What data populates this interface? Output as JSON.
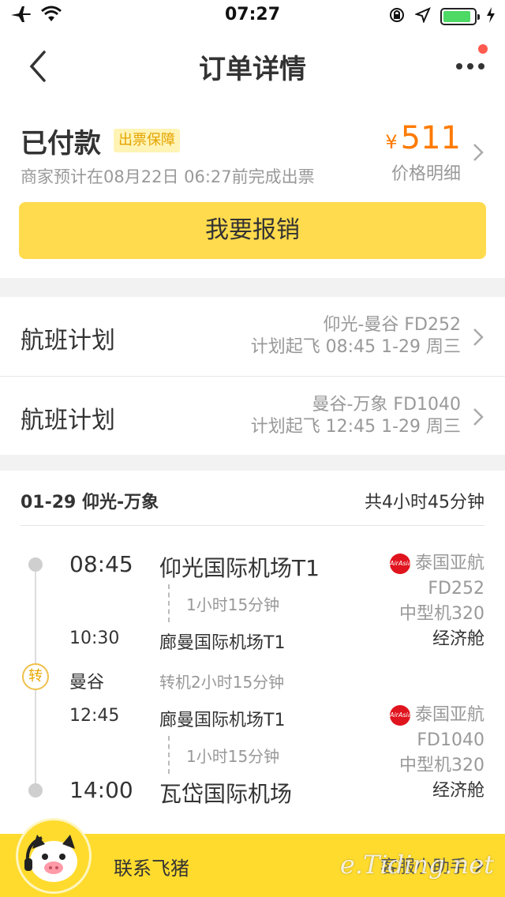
{
  "status_bar": {
    "time": "07:27"
  },
  "nav": {
    "title": "订单详情"
  },
  "order": {
    "status": "已付款",
    "badge": "出票保障",
    "issue_note": "商家预计在08月22日 06:27前完成出票",
    "currency": "¥",
    "price": "511",
    "price_detail": "价格明细",
    "expense_button": "我要报销"
  },
  "flight_plans": [
    {
      "label": "航班计划",
      "route": "仰光-曼谷 FD252",
      "schedule": "计划起飞 08:45 1-29 周三"
    },
    {
      "label": "航班计划",
      "route": "曼谷-万象 FD1040",
      "schedule": "计划起飞 12:45 1-29 周三"
    }
  ],
  "itinerary": {
    "route": "01-29 仰光-万象",
    "total_duration": "共4小时45分钟",
    "transfer_mark": "转",
    "segments": [
      {
        "dep_time": "08:45",
        "dep_airport": "仰光国际机场T1",
        "duration": "1小时15分钟",
        "arr_time": "10:30",
        "arr_airport": "廊曼国际机场T1",
        "airline": "泰国亚航",
        "logo_text": "AirAsia",
        "flight_no": "FD252",
        "aircraft": "中型机320",
        "cabin": "经济舱"
      },
      {
        "dep_time": "12:45",
        "dep_airport": "廊曼国际机场T1",
        "duration": "1小时15分钟",
        "arr_time": "14:00",
        "arr_airport": "瓦岱国际机场",
        "airline": "泰国亚航",
        "logo_text": "AirAsia",
        "flight_no": "FD1040",
        "aircraft": "中型机320",
        "cabin": "经济舱"
      }
    ],
    "transfer_city": "曼谷",
    "transfer_wait": "转机2小时15分钟"
  },
  "bottom": {
    "contact_label": "联系飞猪",
    "assistant_label": "客服小助手"
  },
  "watermark": "e.Tiding.net",
  "colors": {
    "accent_yellow": "#ffdb4d",
    "price_orange": "#ff7a00",
    "airasia_red": "#e0141e"
  }
}
